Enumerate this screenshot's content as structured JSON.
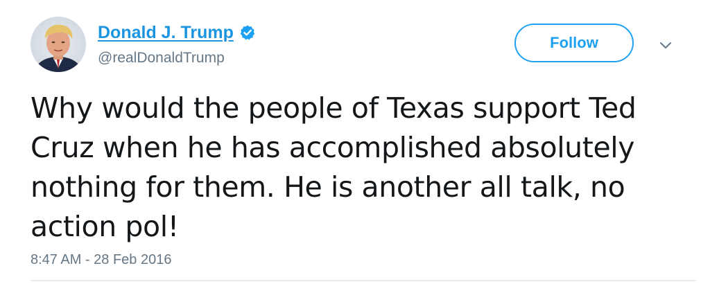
{
  "user": {
    "display_name": "Donald J. Trump",
    "handle": "@realDonaldTrump",
    "verified_icon": "verified-badge-icon",
    "avatar_icon": "avatar"
  },
  "actions": {
    "follow_label": "Follow",
    "menu_icon": "chevron-down-icon"
  },
  "tweet": {
    "text": "Why would the people of Texas support Ted Cruz when he has accomplished absolutely nothing for them. He is another all talk, no action pol!",
    "timestamp": "8:47 AM - 28 Feb 2016"
  },
  "colors": {
    "link_blue": "#1b95e0",
    "follow_blue": "#1da1f2",
    "secondary_text": "#657786",
    "primary_text": "#14171a"
  }
}
